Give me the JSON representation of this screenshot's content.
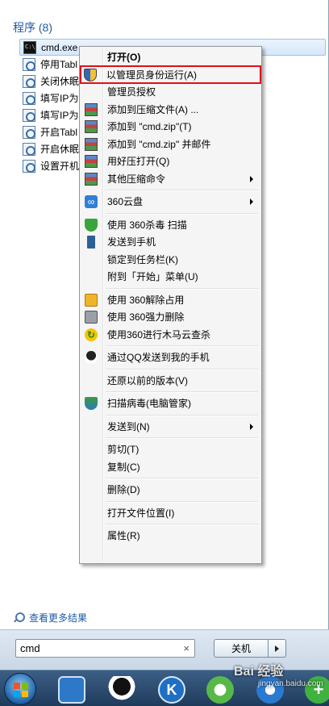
{
  "start_menu": {
    "section_title": "程序 (8)",
    "results": [
      {
        "label": "cmd.exe",
        "icon": "cmd-icon",
        "selected": true
      },
      {
        "label": "停用Tabl",
        "icon": "script-icon"
      },
      {
        "label": "关闭休眠",
        "icon": "script-icon"
      },
      {
        "label": "填写IP为1",
        "icon": "script-icon"
      },
      {
        "label": "填写IP为1",
        "icon": "script-icon"
      },
      {
        "label": "开启Tabl",
        "icon": "script-icon"
      },
      {
        "label": "开启休眠",
        "icon": "script-icon"
      },
      {
        "label": "设置开机",
        "icon": "script-icon"
      }
    ],
    "see_more": "查看更多结果",
    "search": {
      "value": "cmd",
      "clear": "×"
    },
    "shutdown_label": "关机"
  },
  "context_menu": {
    "items": {
      "open": "打开(O)",
      "run_as_admin": "以管理员身份运行(A)",
      "admin_grant": "管理员授权",
      "add_archive": "添加到压缩文件(A) ...",
      "add_cmd_zip": "添加到 \"cmd.zip\"(T)",
      "add_cmd_zip_mail": "添加到 \"cmd.zip\" 并邮件",
      "open_haozip": "用好压打开(Q)",
      "other_compress": "其他压缩命令",
      "cloud360": "360云盘",
      "scan360": "使用 360杀毒 扫描",
      "send_phone": "发送到手机",
      "pin_taskbar": "锁定到任务栏(K)",
      "pin_start": "附到「开始」菜单(U)",
      "unlock360": "使用 360解除占用",
      "force_delete": "使用 360强力删除",
      "trojan_scan": "使用360进行木马云查杀",
      "qq_send": "通过QQ发送到我的手机",
      "restore": "还原以前的版本(V)",
      "guard_scan": "扫描病毒(电脑管家)",
      "send_to": "发送到(N)",
      "cut": "剪切(T)",
      "copy": "复制(C)",
      "delete": "删除(D)",
      "open_location": "打开文件位置(I)",
      "properties": "属性(R)"
    },
    "highlight_color": "#e0101a"
  },
  "taskbar": {
    "k_label": "K",
    "plus_label": "+"
  },
  "watermark": {
    "line1": "Bai 经验",
    "line2": "jingyan.baidu.com"
  }
}
